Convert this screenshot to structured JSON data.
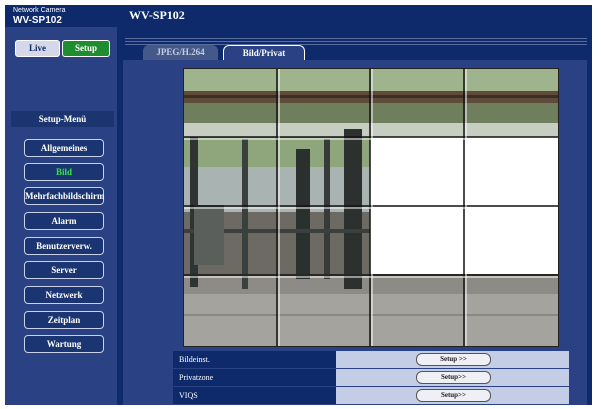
{
  "header": {
    "brand_sub": "Network Camera",
    "brand_model": "WV-SP102",
    "title": "WV-SP102"
  },
  "nav": {
    "live_label": "Live",
    "setup_label": "Setup"
  },
  "sidebar": {
    "menu_title": "Setup-Menü",
    "items": [
      {
        "label": "Allgemeines",
        "active": false
      },
      {
        "label": "Bild",
        "active": true
      },
      {
        "label": "Mehrfachbildschirm",
        "active": false
      },
      {
        "label": "Alarm",
        "active": false
      },
      {
        "label": "Benutzerverw.",
        "active": false
      },
      {
        "label": "Server",
        "active": false
      },
      {
        "label": "Netzwerk",
        "active": false
      },
      {
        "label": "Zeitplan",
        "active": false
      },
      {
        "label": "Wartung",
        "active": false
      }
    ]
  },
  "tabs": [
    {
      "label": "JPEG/H.264",
      "active": false
    },
    {
      "label": "Bild/Privat",
      "active": true
    }
  ],
  "settings_rows": [
    {
      "label": "Bildeinst.",
      "button": "Setup >>"
    },
    {
      "label": "Privatzone",
      "button": "Setup>>"
    },
    {
      "label": "VIQS",
      "button": "Setup>>"
    }
  ],
  "colors": {
    "background": "#0e2a6b",
    "panel": "#2a4283",
    "setup_active": "#1f8d2f",
    "active_item_text": "#36e64a"
  }
}
